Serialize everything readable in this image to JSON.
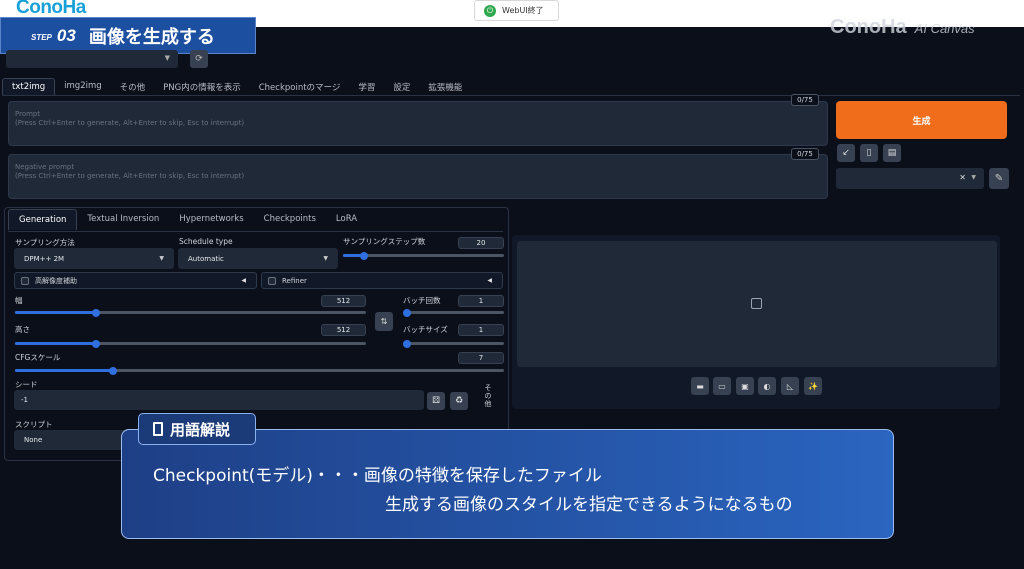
{
  "header": {
    "logo_text": "ConoHa",
    "webui_button": "WebUI終了",
    "step_prefix": "STEP",
    "step_number": "03",
    "step_title": "画像を生成する",
    "brand_name": "ConoHa",
    "brand_product": "AI Canvas"
  },
  "tabs": [
    "txt2img",
    "img2img",
    "その他",
    "PNG内の情報を表示",
    "Checkpointのマージ",
    "学習",
    "設定",
    "拡張機能"
  ],
  "prompt": {
    "placeholder_title": "Prompt",
    "placeholder_hint": "(Press Ctrl+Enter to generate, Alt+Enter to skip, Esc to interrupt)",
    "counter": "0/75"
  },
  "negative_prompt": {
    "placeholder_title": "Negative prompt",
    "placeholder_hint": "(Press Ctrl+Enter to generate, Alt+Enter to skip, Esc to interrupt)",
    "counter": "0/75"
  },
  "generate_button": "生成",
  "subtabs": [
    "Generation",
    "Textual Inversion",
    "Hypernetworks",
    "Checkpoints",
    "LoRA"
  ],
  "sampling": {
    "method_label": "サンプリング方法",
    "method_value": "DPM++ 2M",
    "schedule_label": "Schedule type",
    "schedule_value": "Automatic",
    "steps_label": "サンプリングステップ数",
    "steps_value": "20"
  },
  "hires_label": "高解像度補助",
  "refiner_label": "Refiner",
  "width": {
    "label": "幅",
    "value": "512"
  },
  "height": {
    "label": "高さ",
    "value": "512"
  },
  "batch_count": {
    "label": "バッチ回数",
    "value": "1"
  },
  "batch_size": {
    "label": "バッチサイズ",
    "value": "1"
  },
  "cfg": {
    "label": "CFGスケール",
    "value": "7"
  },
  "seed": {
    "label": "シード",
    "value": "-1"
  },
  "other_label": "その他",
  "script": {
    "label": "スクリプト",
    "value": "None"
  },
  "slider_levels": {
    "steps": 0.13,
    "width": 0.23,
    "height": 0.23,
    "batch_count": 0.0,
    "batch_size": 0.0,
    "cfg": 0.2
  },
  "glossary": {
    "tag": "用語解説",
    "line1": "Checkpoint(モデル)・・・画像の特徴を保存したファイル",
    "line2": "生成する画像のスタイルを指定できるようになるもの"
  },
  "colors": {
    "background": "#0b0f19",
    "accent_orange": "#f06d1c",
    "slider_blue": "#2f6fe0",
    "banner_blue": "#1d4fa0"
  }
}
